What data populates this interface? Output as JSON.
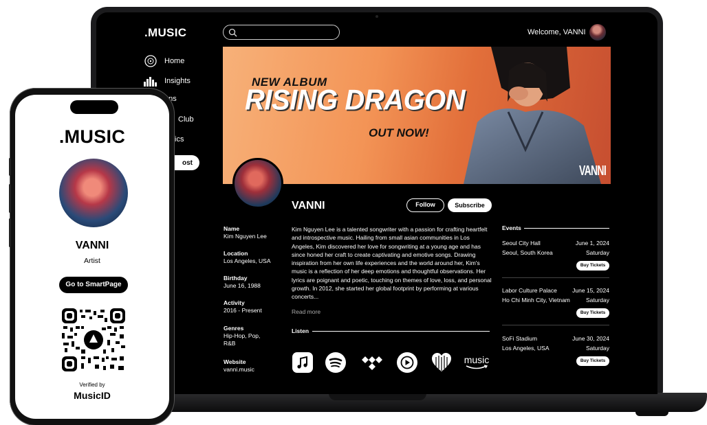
{
  "app": {
    "logo": ".MUSIC",
    "welcome": "Welcome, VANNI"
  },
  "nav": [
    {
      "label": "Home",
      "icon": "vinyl-icon"
    },
    {
      "label": "Insights",
      "icon": "equalizer-icon"
    },
    {
      "label": "ens",
      "icon": ""
    },
    {
      "label": "Club",
      "icon": ""
    },
    {
      "label": "ics",
      "icon": ""
    }
  ],
  "nav_button": "ost",
  "banner": {
    "line1": "NEW ALBUM",
    "title": "RISING DRAGON",
    "line3": "OUT NOW!",
    "signature": "VANNI"
  },
  "artist": {
    "name": "VANNI",
    "follow": "Follow",
    "subscribe": "Subscribe"
  },
  "info": [
    {
      "label": "Name",
      "value": "Kim Nguyen Lee"
    },
    {
      "label": "Location",
      "value": "Los Angeles, USA"
    },
    {
      "label": "Birthday",
      "value": "June 16, 1988"
    },
    {
      "label": "Activity",
      "value": "2016 - Present"
    },
    {
      "label": "Genres",
      "value": "Hip-Hop, Pop, R&B"
    },
    {
      "label": "Website",
      "value": "vanni.music"
    }
  ],
  "bio": "Kim Nguyen Lee is a talented songwriter with a passion for crafting heartfelt and introspective music. Hailing from small asian communities in Los Angeles, Kim discovered her love for songwriting at a young age and has since honed her craft to create captivating and emotive songs. Drawing inspiration from her own life experiences and the world around her, Kim's music is a reflection of her deep emotions and thoughtful observations. Her lyrics are poignant and poetic, touching on themes of love, loss, and personal growth. In 2012, she started her global footprint by performing at various concerts...",
  "read_more": "Read more",
  "listen_label": "Listen",
  "streaming": [
    {
      "name": "apple-music-icon"
    },
    {
      "name": "spotify-icon"
    },
    {
      "name": "tidal-icon"
    },
    {
      "name": "youtube-music-icon"
    },
    {
      "name": "deezer-icon"
    },
    {
      "name": "amazon-music-icon",
      "label": "music"
    }
  ],
  "events_label": "Events",
  "events": [
    {
      "venue": "Seoul City Hall",
      "date": "June 1, 2024",
      "city": "Seoul, South Korea",
      "day": "Saturday",
      "button": "Buy Tickets"
    },
    {
      "venue": "Labor Culture Palace",
      "date": "June 15, 2024",
      "city": "Ho Chi Minh City, Vietnam",
      "day": "Saturday",
      "button": "Buy Tickets"
    },
    {
      "venue": "SoFi Stadium",
      "date": "June 30, 2024",
      "city": "Los Angeles, USA",
      "day": "Saturday",
      "button": "Buy Tickets"
    }
  ],
  "phone": {
    "logo": ".MUSIC",
    "name": "VANNI",
    "role": "Artist",
    "cta": "Go to SmartPage",
    "verified": "Verified by",
    "brand": "MusicID"
  }
}
